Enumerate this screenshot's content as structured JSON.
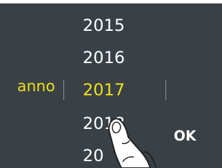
{
  "picker": {
    "label": "anno",
    "years": [
      "2015",
      "2016",
      "2017",
      "2018",
      "20"
    ],
    "selected": "2017"
  },
  "actions": {
    "ok_label": "OK"
  },
  "colors": {
    "background": "#3a4146",
    "accent": "#f0df1c",
    "text": "#ffffff"
  },
  "icons": {
    "gesture": "touch-hand-icon"
  }
}
